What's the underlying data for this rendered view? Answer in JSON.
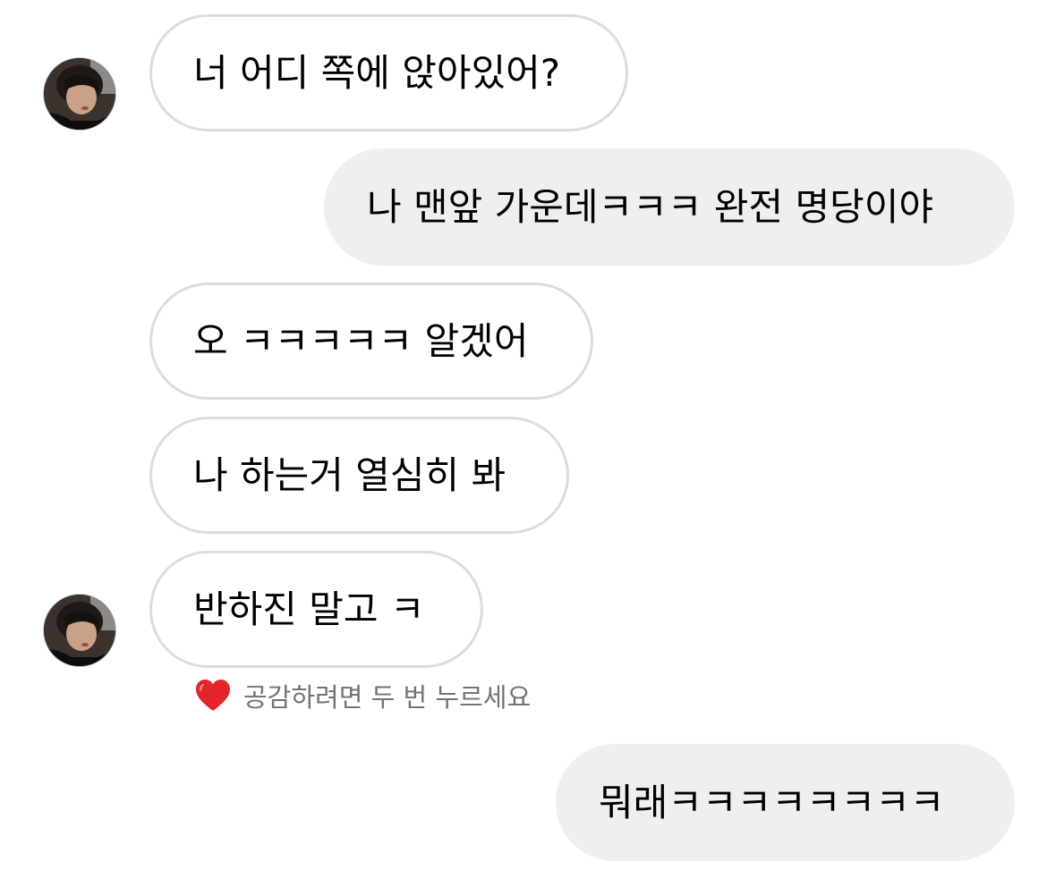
{
  "messages": [
    {
      "sender": "other",
      "text": "너 어디 쪽에 앉아있어?"
    },
    {
      "sender": "me",
      "text": "나 맨앞 가운데ㅋㅋㅋ 완전 명당이야"
    },
    {
      "sender": "other",
      "text": "오 ㅋㅋㅋㅋㅋ 알겠어"
    },
    {
      "sender": "other",
      "text": "나 하는거 열심히 봐"
    },
    {
      "sender": "other",
      "text": "반하진 말고 ㅋ"
    },
    {
      "sender": "me",
      "text": "뭐래ㅋㅋㅋㅋㅋㅋㅋㅋ"
    }
  ],
  "like_hint": {
    "icon": "heart-icon",
    "icon_color": "#e3242b",
    "text": "공감하려면 두 번 누르세요"
  },
  "colors": {
    "incoming_bubble_border": "#dcdcdc",
    "outgoing_bubble_bg": "#efefef",
    "hint_text": "#737373"
  }
}
